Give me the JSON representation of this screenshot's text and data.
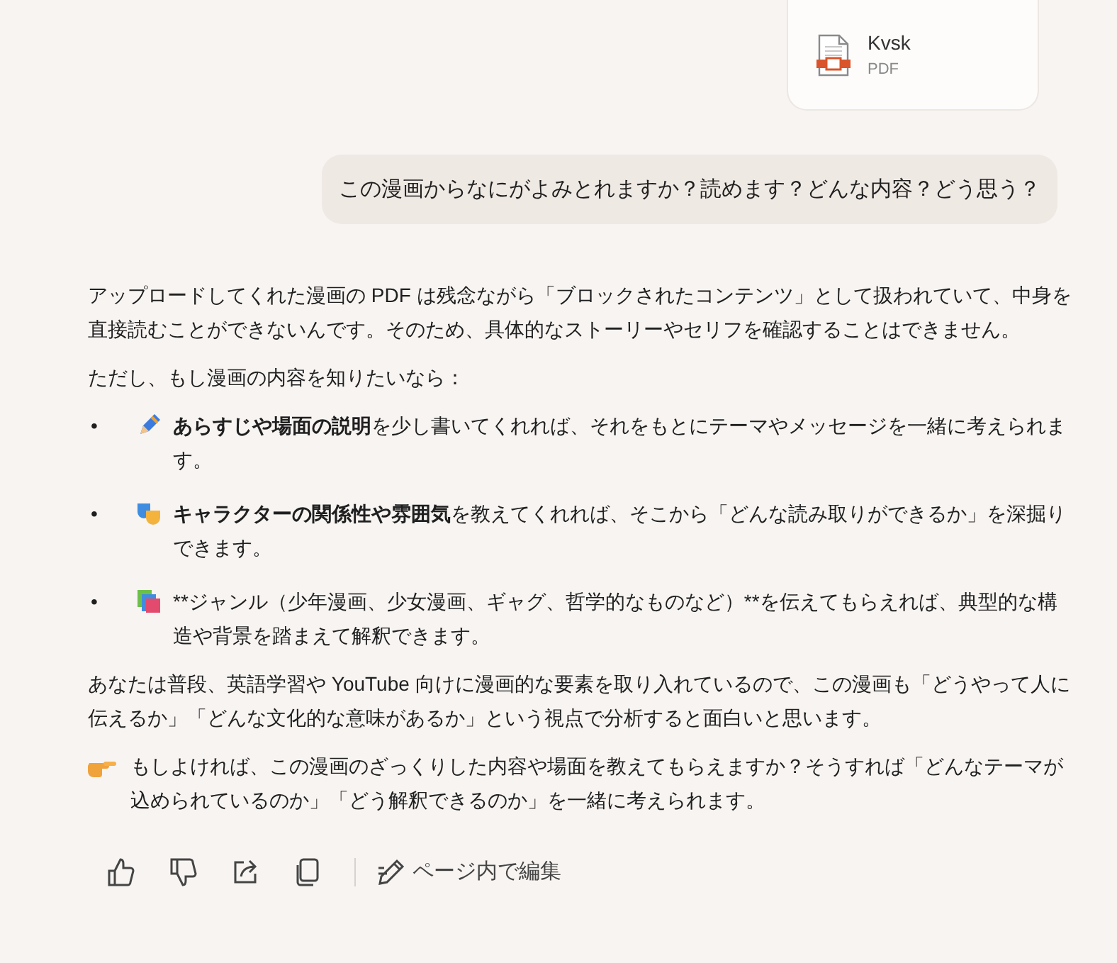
{
  "attachment": {
    "name": "Kvsk",
    "type": "PDF"
  },
  "user_message": "この漫画からなにがよみとれますか？読めます？どんな内容？どう思う？",
  "reply": {
    "intro": "アップロードしてくれた漫画の PDF は残念ながら「ブロックされたコンテンツ」として扱われていて、中身を直接読むことができないんです。そのため、具体的なストーリーやセリフを確認することはできません。",
    "lead": "ただし、もし漫画の内容を知りたいなら：",
    "bullets": [
      {
        "bullet": "•",
        "kind": "pencil",
        "markup": true,
        "text": "**あらすじや場面の説明**を少し書いてくれれば、それをもとにテーマやメッセージを一緒に考えられます。"
      },
      {
        "bullet": "•",
        "kind": "masks",
        "markup": true,
        "text": "**キャラクターの関係性や雰囲気**を教えてくれれば、そこから「どんな読み取りができるか」を深掘りできます。"
      },
      {
        "bullet": "•",
        "kind": "books",
        "markup": false,
        "text": "**ジャンル（少年漫画、少女漫画、ギャグ、哲学的なものなど）**を伝えてもらえれば、典型的な構造や背景を踏まえて解釈できます。"
      }
    ],
    "paragraph": "あなたは普段、英語学習や YouTube 向けに漫画的な要素を取り入れているので、この漫画も「どうやって人に伝えるか」「どんな文化的な意味があるか」という視点で分析すると面白いと思います。",
    "closing": "もしよければ、この漫画のざっくりした内容や場面を教えてもらえますか？そうすれば「どんなテーマが込められているのか」「どう解釈できるのか」を一緒に考えられます。"
  },
  "actions": {
    "edit_label": "ページ内で編集"
  }
}
